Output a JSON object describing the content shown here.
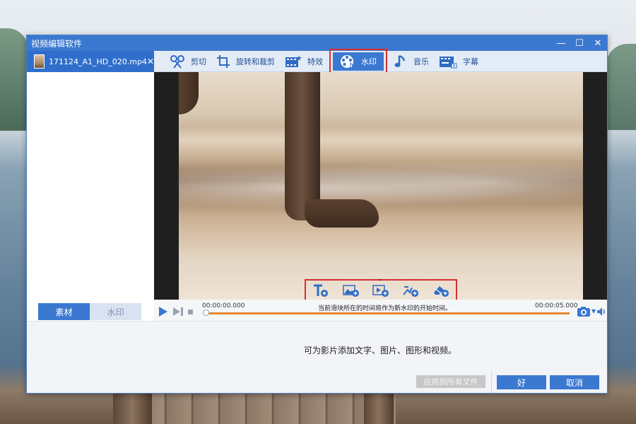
{
  "window": {
    "title": "视频编辑软件",
    "controls": {
      "minimize": "—",
      "maximize": "☐",
      "close": "✕"
    }
  },
  "file_tab": {
    "name": "171124_A1_HD_020.mp4",
    "close": "✕"
  },
  "left_tabs": [
    {
      "label": "素材",
      "active": true
    },
    {
      "label": "水印",
      "active": false
    }
  ],
  "toolbar": {
    "items": [
      {
        "label": "剪切",
        "icon": "cut-icon"
      },
      {
        "label": "旋转和裁剪",
        "icon": "rotate-crop-icon"
      },
      {
        "label": "特效",
        "icon": "effects-icon"
      },
      {
        "label": "水印",
        "icon": "watermark-icon",
        "active": true
      },
      {
        "label": "音乐",
        "icon": "music-icon"
      },
      {
        "label": "字幕",
        "icon": "subtitle-icon"
      }
    ]
  },
  "watermark_tools": [
    {
      "icon": "add-text-icon"
    },
    {
      "icon": "add-image-icon"
    },
    {
      "icon": "add-video-icon"
    },
    {
      "icon": "add-shape-icon"
    },
    {
      "icon": "add-eraser-icon"
    }
  ],
  "player": {
    "time_start": "00:00:00.000",
    "time_end": "00:00:05.000",
    "hint": "当前滑块所在的时间将作为新水印的开始时间。"
  },
  "hint_text": "可为影片添加文字、图片、图形和视频。",
  "footer": {
    "apply_all": "应用到所有文件",
    "ok": "好",
    "cancel": "取消"
  },
  "colors": {
    "accent": "#3b78d0",
    "highlight": "#d62f2f",
    "timeline": "#e8862c"
  }
}
